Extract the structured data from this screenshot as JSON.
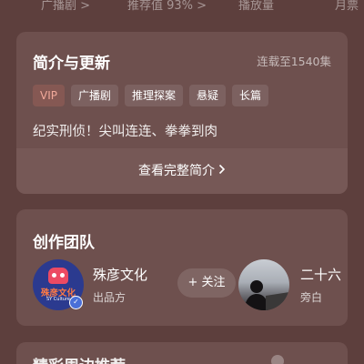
{
  "stats": [
    "广播剧 >",
    "推荐值 93% >",
    "播放量",
    "月票"
  ],
  "intro": {
    "title": "简介与更新",
    "episode_count": "连载至1540集",
    "tags": [
      "VIP",
      "广播剧",
      "推理探案",
      "悬疑",
      "长篇"
    ],
    "description": "纪实刑侦！尖叫连连、拳拳到肉",
    "more_label": "查看完整简介",
    "more_icon": "chevron-right-icon"
  },
  "team": {
    "title": "创作团队",
    "members": [
      {
        "name": "殊彦文化",
        "role": "出品方",
        "avatar_text": "殊彦文化",
        "avatar_subtext": "SY Culture",
        "verified_icon": "verified-check-icon"
      },
      {
        "name": "二十六",
        "role": "旁白"
      }
    ],
    "follow_label": "+ 关注"
  },
  "next_section": {
    "title": "精彩周边推荐"
  },
  "colors": {
    "background": "#5d3f3d",
    "card": "#6e504e",
    "vip_tag": "#f1a99a",
    "avatar_bg": "#2b3a8f"
  }
}
